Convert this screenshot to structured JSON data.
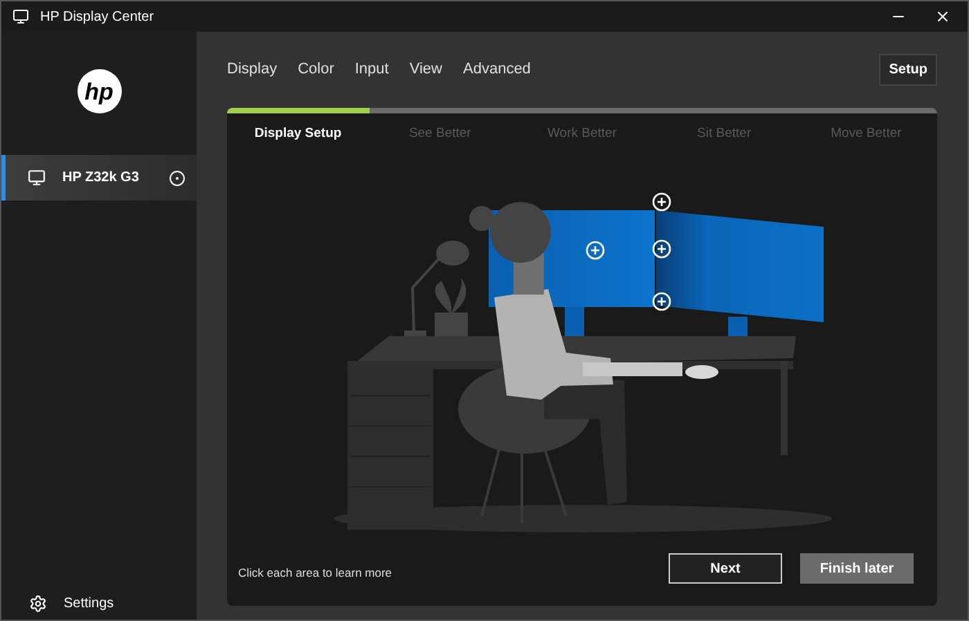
{
  "window": {
    "title": "HP Display Center"
  },
  "sidebar": {
    "logo": "hp",
    "devices": [
      {
        "name": "HP Z32k G3",
        "selected": true
      }
    ],
    "settings_label": "Settings"
  },
  "nav": {
    "tabs": [
      {
        "label": "Display"
      },
      {
        "label": "Color"
      },
      {
        "label": "Input"
      },
      {
        "label": "View"
      },
      {
        "label": "Advanced"
      }
    ],
    "setup_button": "Setup"
  },
  "wizard": {
    "progress": {
      "level": 0.2
    },
    "steps": [
      {
        "label": "Display Setup",
        "selected": true
      },
      {
        "label": "See Better",
        "selected": false
      },
      {
        "label": "Work Better",
        "selected": false
      },
      {
        "label": "Sit Better",
        "selected": false
      },
      {
        "label": "Move Better",
        "selected": false
      }
    ],
    "hint": "Click each area to learn more",
    "buttons": [
      {
        "label": "Next",
        "kind": "outline"
      },
      {
        "label": "Finish later",
        "kind": "filled"
      }
    ]
  }
}
